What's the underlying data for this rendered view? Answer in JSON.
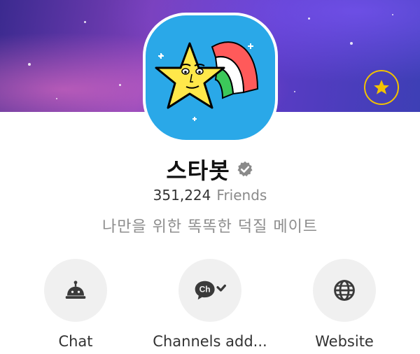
{
  "profile": {
    "name": "스타봇",
    "friends_count": "351,224",
    "friends_label": "Friends",
    "description": "나만을 위한 똑똑한 덕질 메이트",
    "verified_icon": "verified-badge-icon",
    "favorite_icon": "star-icon"
  },
  "actions": [
    {
      "label": "Chat",
      "icon": "chat-bell-icon"
    },
    {
      "label": "Channels add...",
      "icon": "channel-add-icon"
    },
    {
      "label": "Website",
      "icon": "globe-icon"
    }
  ],
  "colors": {
    "avatar_bg": "#2aa8e8",
    "favorite_ring": "#f2c200",
    "action_bg": "#f0f0f0"
  }
}
